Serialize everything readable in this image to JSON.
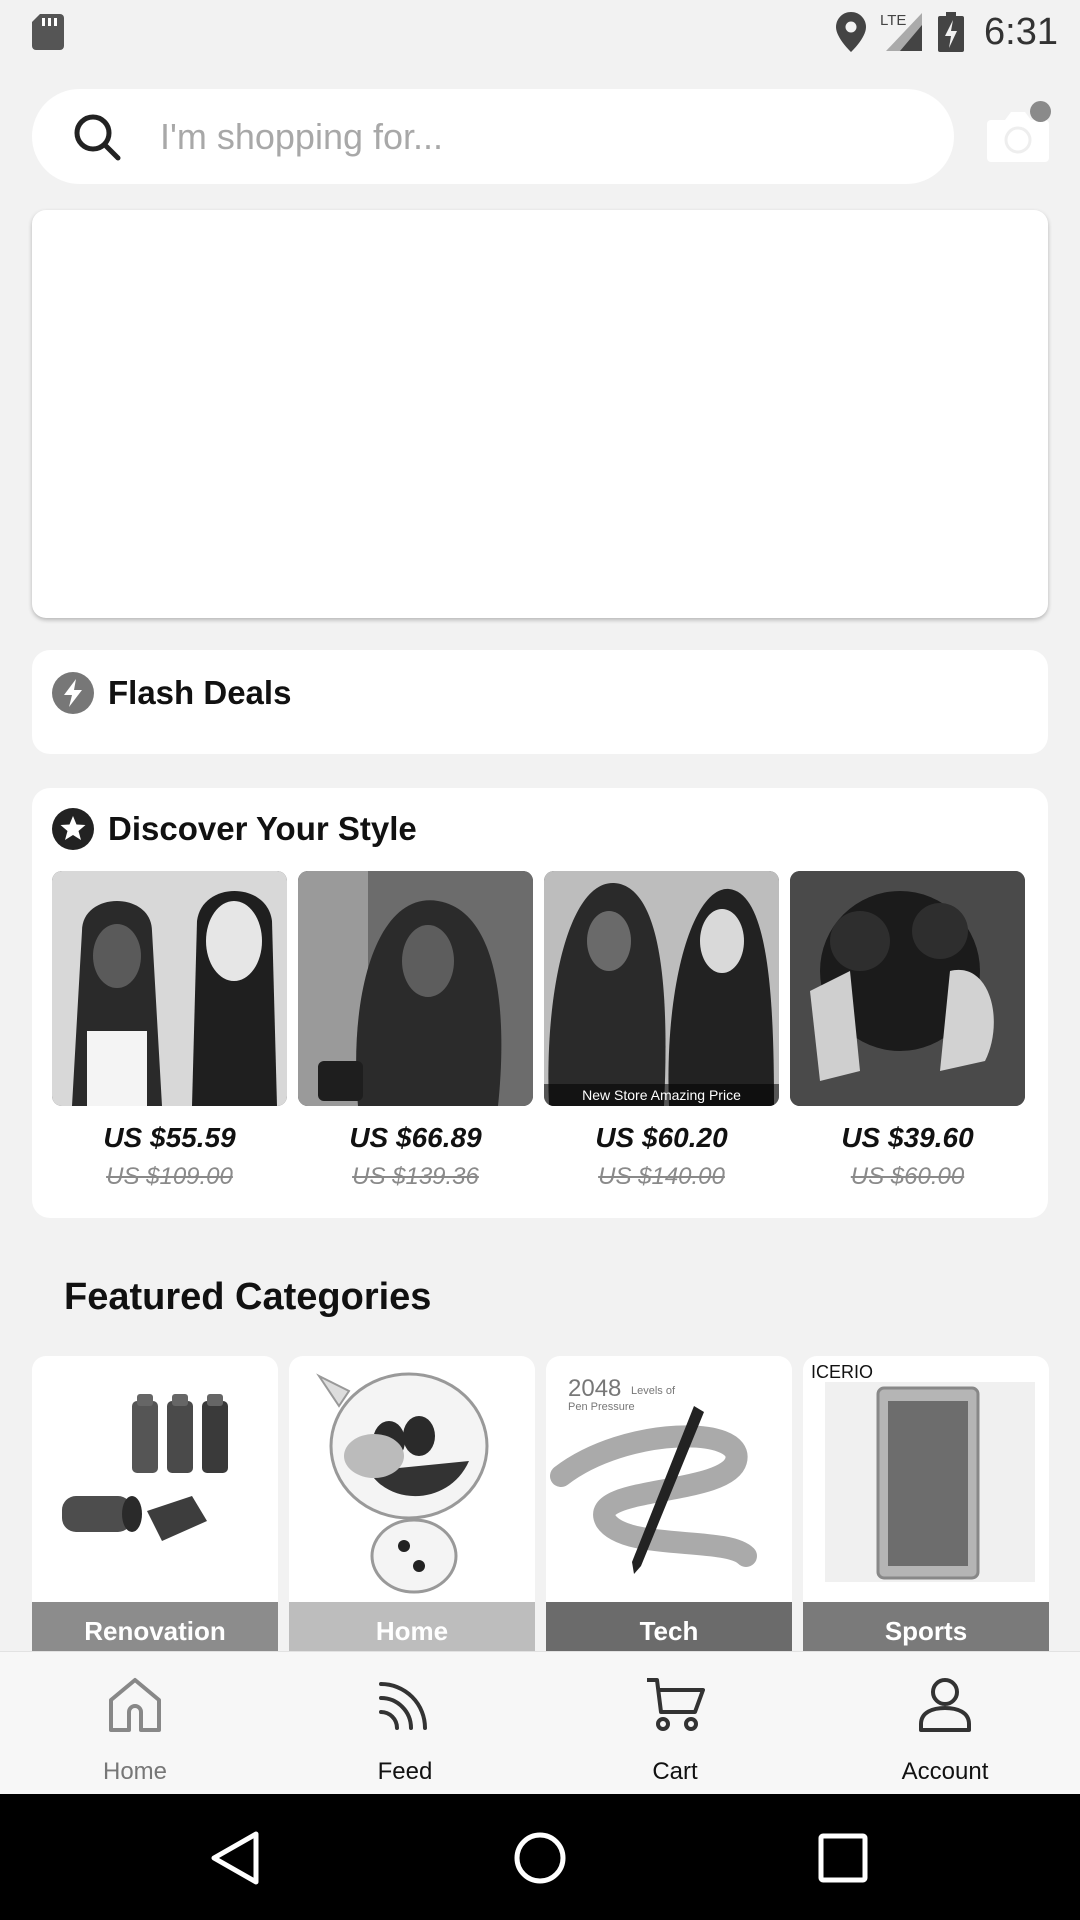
{
  "status_bar": {
    "time": "6:31",
    "network": "LTE"
  },
  "search": {
    "placeholder": "I'm shopping for..."
  },
  "flash_deals": {
    "title": "Flash Deals"
  },
  "discover": {
    "title": "Discover Your Style",
    "products": [
      {
        "price": "US $55.59",
        "original_price": "US $109.00",
        "caption": ""
      },
      {
        "price": "US $66.89",
        "original_price": "US $139.36",
        "caption": ""
      },
      {
        "price": "US $60.20",
        "original_price": "US $140.00",
        "caption": "New Store Amazing Price"
      },
      {
        "price": "US $39.60",
        "original_price": "US $60.00",
        "caption": ""
      }
    ]
  },
  "featured": {
    "title": "Featured Categories",
    "categories": [
      {
        "label": "Renovation",
        "color": "#8c8c8c"
      },
      {
        "label": "Home",
        "color": "#bdbdbd"
      },
      {
        "label": "Tech",
        "color": "#6b6b6b"
      },
      {
        "label": "Sports",
        "color": "#7a7a7a",
        "brand": "ICERIO"
      }
    ],
    "tech_image_text": {
      "big": "2048",
      "small1": "Levels of",
      "small2": "Pen Pressure"
    }
  },
  "bottom_nav": {
    "items": [
      {
        "label": "Home",
        "icon": "home-icon",
        "active": true
      },
      {
        "label": "Feed",
        "icon": "feed-icon"
      },
      {
        "label": "Cart",
        "icon": "cart-icon"
      },
      {
        "label": "Account",
        "icon": "account-icon"
      }
    ]
  },
  "colors": {
    "background": "#f2f2f2",
    "card": "#ffffff",
    "accent": "#333333"
  }
}
